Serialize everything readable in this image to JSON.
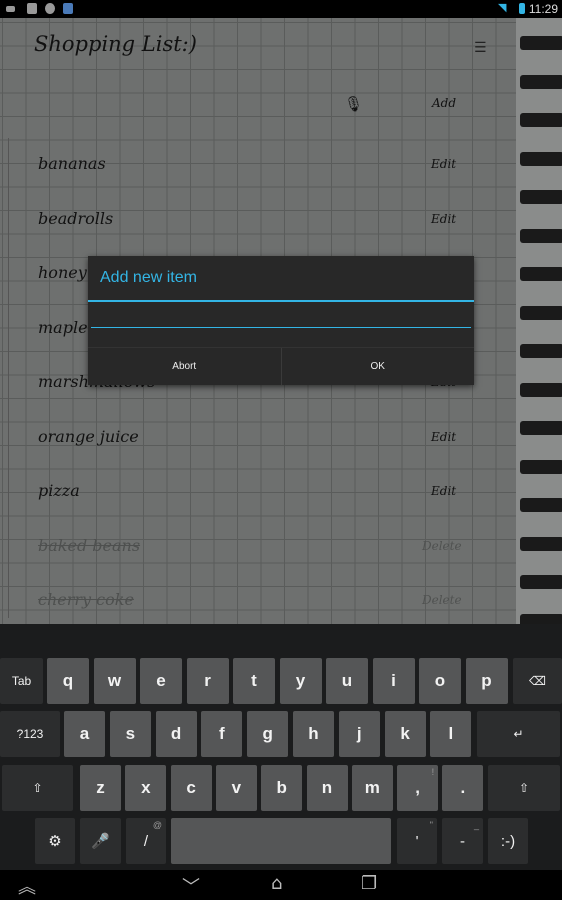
{
  "status_bar": {
    "time": "11:29",
    "icons": [
      "keyboard-icon",
      "sd-card-icon",
      "app-icon",
      "translate-icon",
      "wifi-icon",
      "battery-icon"
    ]
  },
  "app": {
    "title": "Shopping List:)",
    "add_label": "Add",
    "icons": {
      "settings": "sliders-icon",
      "voice": "microphone-icon"
    }
  },
  "items": [
    {
      "name": "bananas",
      "action": "Edit",
      "done": false
    },
    {
      "name": "beadrolls",
      "action": "Edit",
      "done": false
    },
    {
      "name": "honey",
      "action": "Edit",
      "done": false
    },
    {
      "name": "maple",
      "action": "Edit",
      "done": false
    },
    {
      "name": "marshmallows",
      "action": "Edit",
      "done": false
    },
    {
      "name": "orange juice",
      "action": "Edit",
      "done": false
    },
    {
      "name": "pizza",
      "action": "Edit",
      "done": false
    },
    {
      "name": "baked beans",
      "action": "Delete",
      "done": true
    },
    {
      "name": "cherry coke",
      "action": "Delete",
      "done": true
    }
  ],
  "dialog": {
    "title": "Add new item",
    "input_value": "",
    "abort": "Abort",
    "ok": "OK",
    "accent": "#33b5e5"
  },
  "keyboard": {
    "row1": [
      "Tab",
      "q",
      "w",
      "e",
      "r",
      "t",
      "y",
      "u",
      "i",
      "o",
      "p",
      "⌫"
    ],
    "row2": [
      "?123",
      "a",
      "s",
      "d",
      "f",
      "g",
      "h",
      "j",
      "k",
      "l",
      "↵"
    ],
    "row3": [
      "⇧",
      "z",
      "x",
      "c",
      "v",
      "b",
      "n",
      "m",
      ",",
      ".",
      "⇧"
    ],
    "row3_hints": {
      ",": "!",
      ".": "?"
    },
    "row4": [
      "⚙",
      "🎤",
      "/",
      "",
      "'",
      "-",
      ":-)"
    ],
    "row4_hints": {
      "/": "@",
      "'": "\"",
      "-": "_"
    }
  }
}
